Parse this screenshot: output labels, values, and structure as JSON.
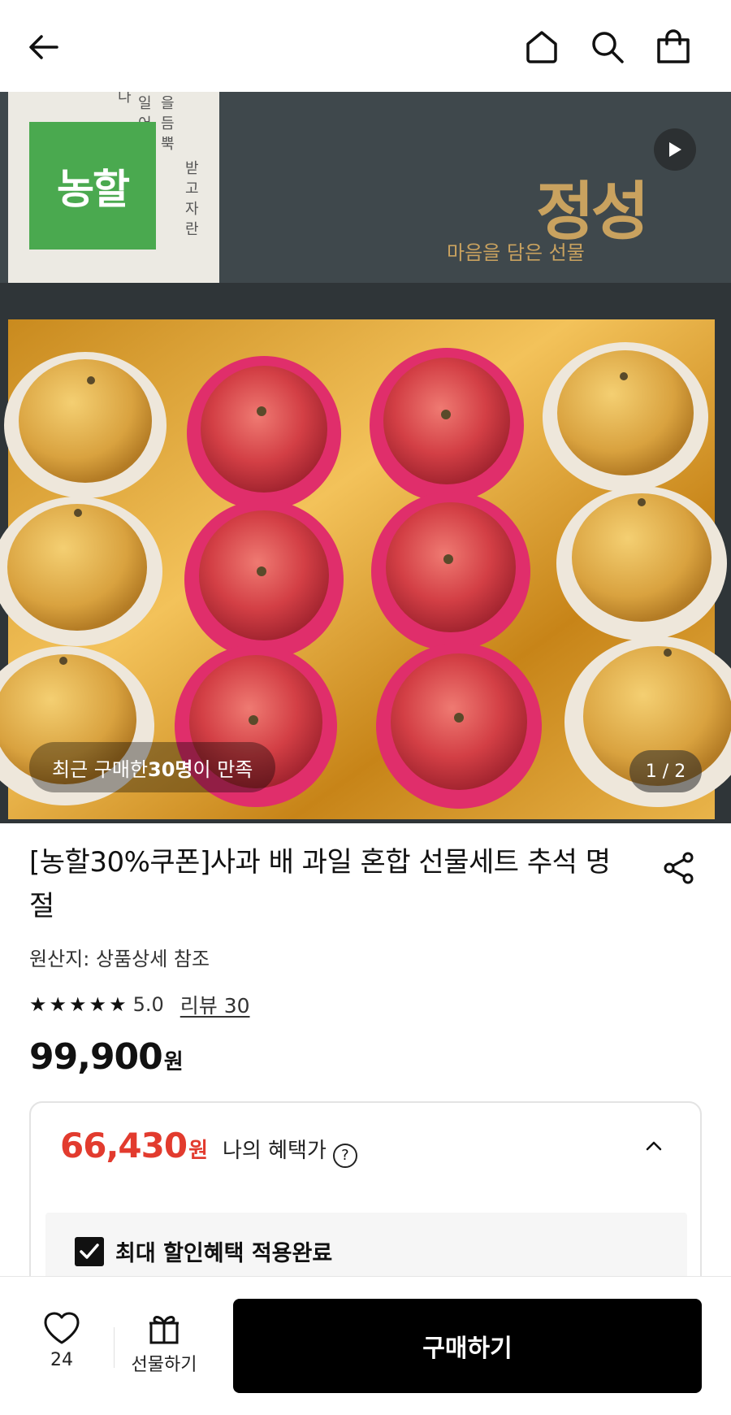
{
  "hero": {
    "brand_badge": "농할",
    "box_title": "정성",
    "box_subtitle": "마음을 담은 선물",
    "recent_prefix": "최근 구매한 ",
    "recent_count": "30명",
    "recent_suffix": "이 만족",
    "counter": "1 / 2"
  },
  "product": {
    "title": "[농할30%쿠폰]사과 배 과일 혼합 선물세트 추석 명절",
    "origin": "원산지: 상품상세 참조",
    "rating": "5.0",
    "rating_stars": 5,
    "review_link": "리뷰 30",
    "price": "99,900",
    "price_unit": "원"
  },
  "benefit": {
    "price": "66,430",
    "price_unit": "원",
    "label": "나의 혜택가",
    "help": "?",
    "check_label": "최대 할인혜택 적용완료"
  },
  "bottom": {
    "like_count": "24",
    "gift_label": "선물하기",
    "buy_label": "구매하기"
  },
  "colors": {
    "accent_red": "#e23b2e",
    "brand_green": "#4aa94f",
    "buy_button": "#000000"
  }
}
